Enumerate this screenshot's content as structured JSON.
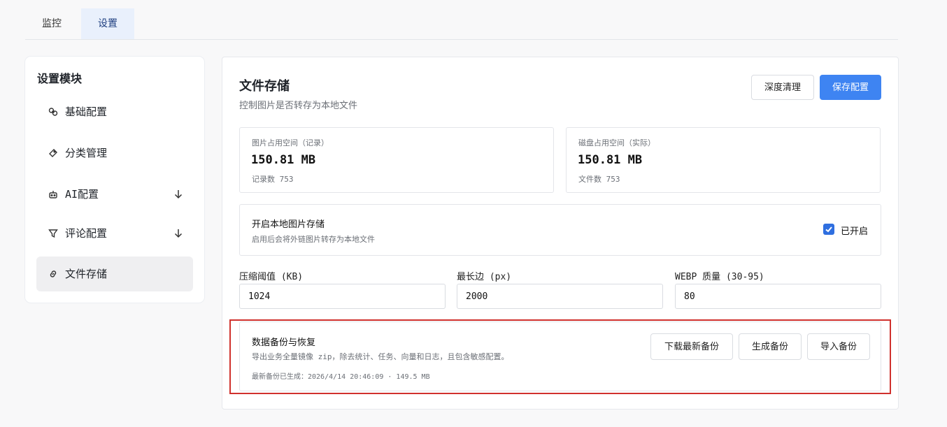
{
  "tabs": [
    {
      "label": "监控"
    },
    {
      "label": "设置"
    }
  ],
  "sidebar": {
    "title": "设置模块",
    "items": [
      {
        "label": "基础配置",
        "icon": "link-icon"
      },
      {
        "label": "分类管理",
        "icon": "tag-icon"
      },
      {
        "label": "AI配置",
        "icon": "robot-icon"
      },
      {
        "label": "评论配置",
        "icon": "filter-icon"
      },
      {
        "label": "文件存储",
        "icon": "link-icon"
      }
    ]
  },
  "main": {
    "title": "文件存储",
    "subtitle": "控制图片是否转存为本地文件",
    "deep_clean_label": "深度清理",
    "save_label": "保存配置",
    "stats": [
      {
        "label": "图片占用空间（记录）",
        "value": "150.81 MB",
        "sub": "记录数 753"
      },
      {
        "label": "磁盘占用空间（实际）",
        "value": "150.81 MB",
        "sub": "文件数 753"
      }
    ],
    "local_storage": {
      "title": "开启本地图片存储",
      "desc": "启用后会将外链图片转存为本地文件",
      "checkbox_label": "已开启",
      "checked": true
    },
    "fields": [
      {
        "label": "压缩阈值 (KB)",
        "value": "1024"
      },
      {
        "label": "最长边 (px)",
        "value": "2000"
      },
      {
        "label": "WEBP 质量 (30-95)",
        "value": "80"
      }
    ],
    "backup": {
      "title": "数据备份与恢复",
      "desc": "导出业务全量镜像 zip，除去统计、任务、向量和日志，且包含敏感配置。",
      "status": "最新备份已生成：2026/4/14 20:46:09 · 149.5 MB",
      "download_label": "下载最新备份",
      "generate_label": "生成备份",
      "import_label": "导入备份"
    }
  },
  "colors": {
    "accent": "#3e84f2",
    "active_tab_bg": "#e9f0fc",
    "highlight": "#d0312d"
  }
}
